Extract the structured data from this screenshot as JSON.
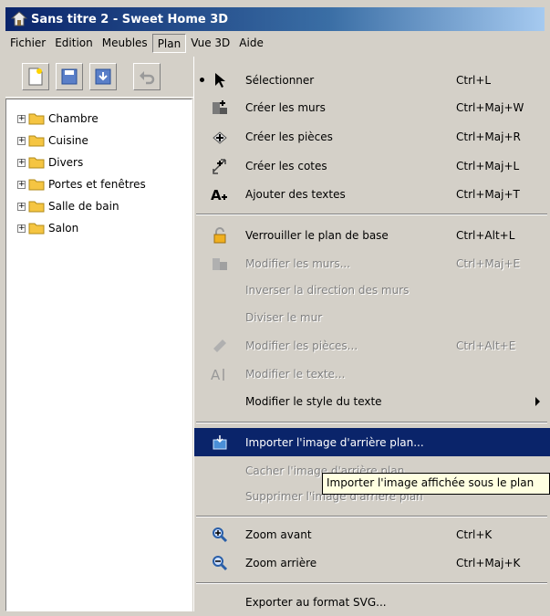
{
  "window": {
    "title": "Sans titre 2 - Sweet Home 3D"
  },
  "menubar": [
    "Fichier",
    "Edition",
    "Meubles",
    "Plan",
    "Vue 3D",
    "Aide"
  ],
  "toolbar": {
    "icons": [
      "new-document-icon",
      "save-icon",
      "open-icon",
      "undo-icon"
    ]
  },
  "tree": {
    "items": [
      "Chambre",
      "Cuisine",
      "Divers",
      "Portes et fenêtres",
      "Salle de bain",
      "Salon"
    ]
  },
  "plan_menu": {
    "items": [
      {
        "label": "Sélectionner",
        "shortcut": "Ctrl+L",
        "icon": "arrow-cursor-icon",
        "enabled": true,
        "checked": true
      },
      {
        "label": "Créer les murs",
        "shortcut": "Ctrl+Maj+W",
        "icon": "wall-icon",
        "enabled": true
      },
      {
        "label": "Créer les pièces",
        "shortcut": "Ctrl+Maj+R",
        "icon": "room-icon",
        "enabled": true
      },
      {
        "label": "Créer les cotes",
        "shortcut": "Ctrl+Maj+L",
        "icon": "dimension-icon",
        "enabled": true
      },
      {
        "label": "Ajouter des textes",
        "shortcut": "Ctrl+Maj+T",
        "icon": "add-text-icon",
        "enabled": true
      },
      {
        "label": "Verrouiller le plan de base",
        "shortcut": "Ctrl+Alt+L",
        "icon": "lock-icon",
        "enabled": true
      },
      {
        "label": "Modifier les murs...",
        "shortcut": "Ctrl+Maj+E",
        "icon": "modify-walls-icon",
        "enabled": false
      },
      {
        "label": "Inverser la direction des murs",
        "shortcut": "",
        "enabled": false
      },
      {
        "label": "Diviser le mur",
        "shortcut": "",
        "enabled": false
      },
      {
        "label": "Modifier les pièces...",
        "shortcut": "Ctrl+Alt+E",
        "icon": "modify-rooms-icon",
        "enabled": false
      },
      {
        "label": "Modifier le texte...",
        "shortcut": "",
        "icon": "modify-text-icon",
        "enabled": false
      },
      {
        "label": "Modifier le style du texte",
        "shortcut": "",
        "enabled": true,
        "submenu": true
      },
      {
        "label": "Importer l'image d'arrière plan...",
        "shortcut": "",
        "icon": "import-image-icon",
        "enabled": true,
        "selected": true
      },
      {
        "label": "Cacher l'image d'arrière plan",
        "shortcut": "",
        "enabled": false
      },
      {
        "label": "Supprimer l'image d'arrière plan",
        "shortcut": "",
        "enabled": false
      },
      {
        "label": "Zoom avant",
        "shortcut": "Ctrl+K",
        "icon": "zoom-in-icon",
        "enabled": true
      },
      {
        "label": "Zoom arrière",
        "shortcut": "Ctrl+Maj+K",
        "icon": "zoom-out-icon",
        "enabled": true
      },
      {
        "label": "Exporter au format SVG...",
        "shortcut": "",
        "enabled": true
      }
    ]
  },
  "tooltip": {
    "text": "Importer l'image affichée sous le plan"
  },
  "colors": {
    "highlight": "#0a246a",
    "menu_bg": "#d4d0c8",
    "tooltip_bg": "#ffffe1",
    "folder": "#f5c542"
  }
}
